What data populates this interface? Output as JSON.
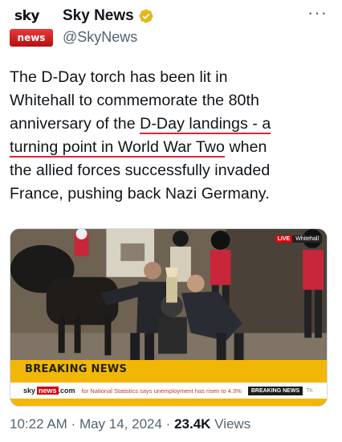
{
  "account": {
    "avatar_top": "sky",
    "avatar_bottom": "news",
    "display_name": "Sky News",
    "handle": "@SkyNews",
    "more_label": "···"
  },
  "tweet": {
    "line1": "The D-Day torch has been lit in",
    "line2": "Whitehall to commemorate the 80th",
    "line3_pre": "anniversary of the ",
    "line3_ul": "D-Day landings - a",
    "line4_ul": "turning point in World War Two",
    "line4_post": " when",
    "line5": "the allied forces successfully invaded",
    "line6": "France, pushing back Nazi Germany."
  },
  "media": {
    "live_label": "LIVE",
    "location": "Whitehall",
    "breaking_label": "BREAKING NEWS",
    "ticker_logo_a": "sky",
    "ticker_logo_b": "news",
    "ticker_logo_c": ".com",
    "ticker_text": "for National Statistics says unemployment has risen to 4.3%",
    "ticker_tag": "BREAKING NEWS",
    "ticker_tail": "Th"
  },
  "meta": {
    "time": "10:22 AM",
    "sep1": " · ",
    "date": "May 14, 2024",
    "sep2": " · ",
    "views_count": "23.4K",
    "views_label": " Views"
  },
  "colors": {
    "underline": "#e02434",
    "verified_gold": "#e2b719",
    "breaking_yellow": "#f2b705",
    "sky_red": "#d10a11"
  }
}
